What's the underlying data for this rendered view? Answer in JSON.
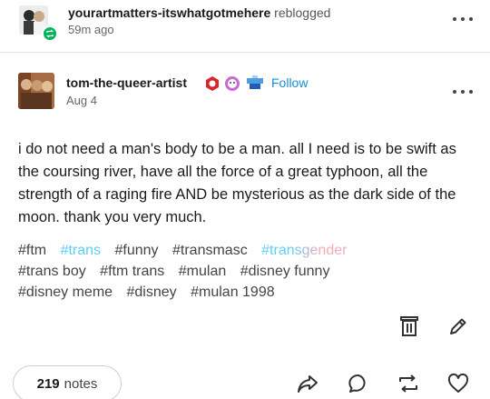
{
  "reblog": {
    "user": "yourartmatters-itswhatgotmehere",
    "verb": "reblogged",
    "time": "59m ago"
  },
  "post": {
    "author": "tom-the-queer-artist",
    "follow_label": "Follow",
    "date": "Aug 4",
    "body": "i do not need a man's body to be a man. all I need is to be swift as the coursing river, have all the force of a great typhoon, all the strength of a raging fire AND be mysterious as the dark side of the moon. thank you very much."
  },
  "tags": [
    "#ftm",
    "#trans",
    "#funny",
    "#transmasc",
    "#transgender",
    "#trans boy",
    "#ftm trans",
    "#mulan",
    "#disney funny",
    "#disney meme",
    "#disney",
    "#mulan 1998"
  ],
  "footer": {
    "notes_count": "219",
    "notes_label": "notes"
  },
  "icons": {
    "reblog_badge": "reblog-icon",
    "more": "more-options-icon",
    "delete": "trash-icon",
    "edit": "pencil-icon",
    "share": "share-icon",
    "reply": "comment-icon",
    "reblog": "reblog-icon",
    "like": "heart-icon"
  },
  "colors": {
    "accent": "#1a8cd8",
    "reblog_green": "#00b35c",
    "trans_blue": "#5bcefa",
    "trans_pink": "#f5a9b8"
  }
}
